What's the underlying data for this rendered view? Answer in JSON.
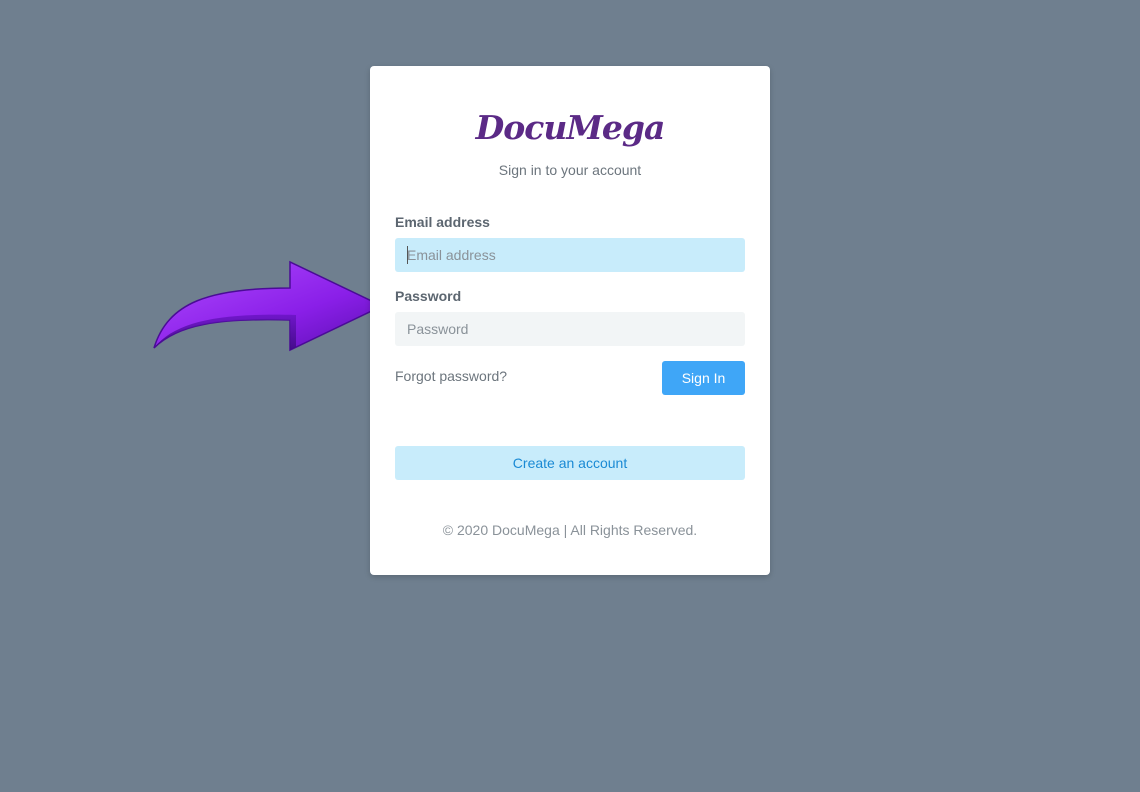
{
  "brand": {
    "logo_text": "DocuMega",
    "logo_color": "#5b2a86"
  },
  "login": {
    "subtitle": "Sign in to your account",
    "email_label": "Email address",
    "email_placeholder": "Email address",
    "email_value": "",
    "password_label": "Password",
    "password_placeholder": "Password",
    "password_value": "",
    "forgot_link": "Forgot password?",
    "signin_button": "Sign In",
    "create_account_button": "Create an account",
    "footer": "© 2020 DocuMega | All Rights Reserved."
  },
  "colors": {
    "background": "#6f7f8f",
    "primary_button": "#3fa6f7",
    "focused_input": "#c8ecfb",
    "arrow": "#8a1fe8"
  },
  "annotation": {
    "icon": "purple-arrow-icon"
  }
}
